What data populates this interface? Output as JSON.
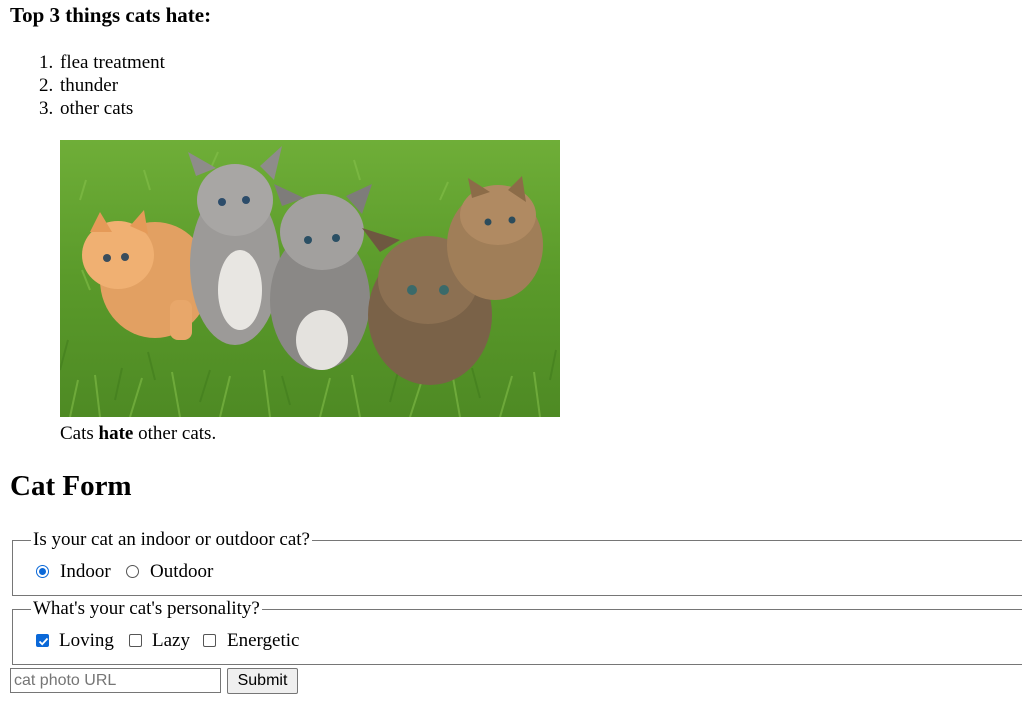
{
  "top_list": {
    "heading": "Top 3 things cats hate:",
    "items": [
      {
        "num": "1.",
        "text": "flea treatment"
      },
      {
        "num": "2.",
        "text": "thunder"
      },
      {
        "num": "3.",
        "text": "other cats"
      }
    ]
  },
  "photo": {
    "caption_before": "Cats ",
    "caption_bold": "hate",
    "caption_after": " other cats."
  },
  "form": {
    "title": "Cat Form",
    "location": {
      "legend": "Is your cat an indoor or outdoor cat?",
      "options": [
        {
          "label": "Indoor",
          "checked": true
        },
        {
          "label": "Outdoor",
          "checked": false
        }
      ]
    },
    "personality": {
      "legend": "What's your cat's personality?",
      "options": [
        {
          "label": "Loving",
          "checked": true
        },
        {
          "label": "Lazy",
          "checked": false
        },
        {
          "label": "Energetic",
          "checked": false
        }
      ]
    },
    "photo_url": {
      "value": "",
      "placeholder": "cat photo URL"
    },
    "submit_label": "Submit"
  },
  "colors": {
    "accent": "#0a68d8",
    "grass": "#5d9a2c"
  }
}
